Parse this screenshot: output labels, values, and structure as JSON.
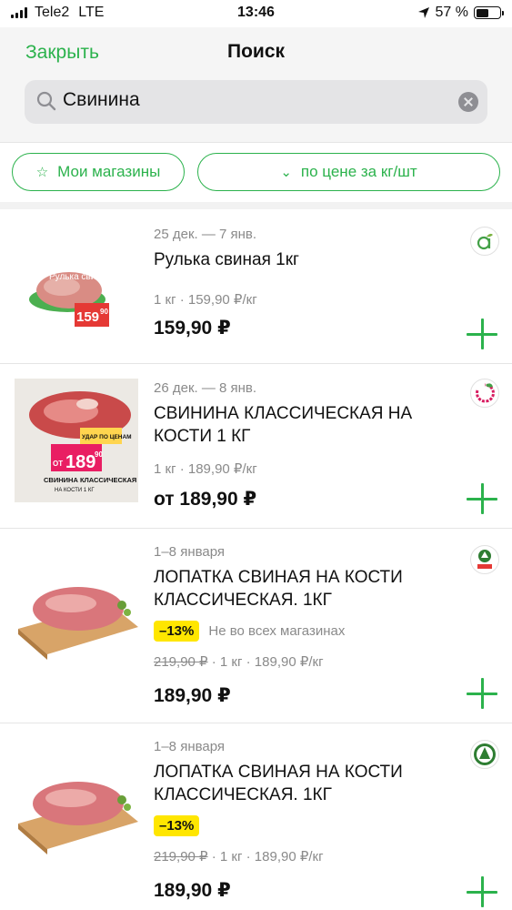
{
  "status_bar": {
    "carrier": "Tele2",
    "network": "LTE",
    "time": "13:46",
    "battery": "57 %"
  },
  "header": {
    "close_label": "Закрыть",
    "title": "Поиск"
  },
  "search": {
    "value": "Свинина"
  },
  "filters": {
    "stores_label": "Мои магазины",
    "sort_label": "по цене за кг/шт"
  },
  "colors": {
    "accent": "#2bb24c",
    "discount": "#ffe600"
  },
  "products": [
    {
      "date": "25 дек. — 7 янв.",
      "name": "Рулька свиная 1кг",
      "unit": "1 кг · 159,90 ₽/кг",
      "price": "159,90 ₽",
      "store_icon": "store-green-a-logo",
      "img_label": "Рулька свиная 1кг",
      "img_price": "159",
      "img_price_cents": "90"
    },
    {
      "date": "26 дек. — 8 янв.",
      "name": "СВИНИНА КЛАССИЧЕСКАЯ НА КОСТИ 1 КГ",
      "unit": "1 кг · 189,90 ₽/кг",
      "price": "от 189,90 ₽",
      "store_icon": "store-pink-leaf-logo",
      "img_tag": "УДАР ПО ЦЕНАМ",
      "img_from": "ОТ",
      "img_price": "189",
      "img_price_cents": "90",
      "img_caption": "СВИНИНА КЛАССИЧЕСКАЯ",
      "img_caption_small": "НА КОСТИ 1 КГ"
    },
    {
      "date": "1–8 января",
      "name": "ЛОПАТКА СВИНАЯ НА КОСТИ КЛАССИЧЕСКАЯ. 1КГ",
      "discount": "–13%",
      "availability": "Не во всех магазинах",
      "old_price": "219,90 ₽",
      "unit": " · 1 кг · 189,90 ₽/кг",
      "price": "189,90 ₽",
      "store_icon": "store-spar-logo"
    },
    {
      "date": "1–8 января",
      "name": "ЛОПАТКА СВИНАЯ НА КОСТИ КЛАССИЧЕСКАЯ. 1КГ",
      "discount": "–13%",
      "old_price": "219,90 ₽",
      "unit": " · 1 кг · 189,90 ₽/кг",
      "price": "189,90 ₽",
      "store_icon": "store-spar-tree-logo"
    }
  ]
}
